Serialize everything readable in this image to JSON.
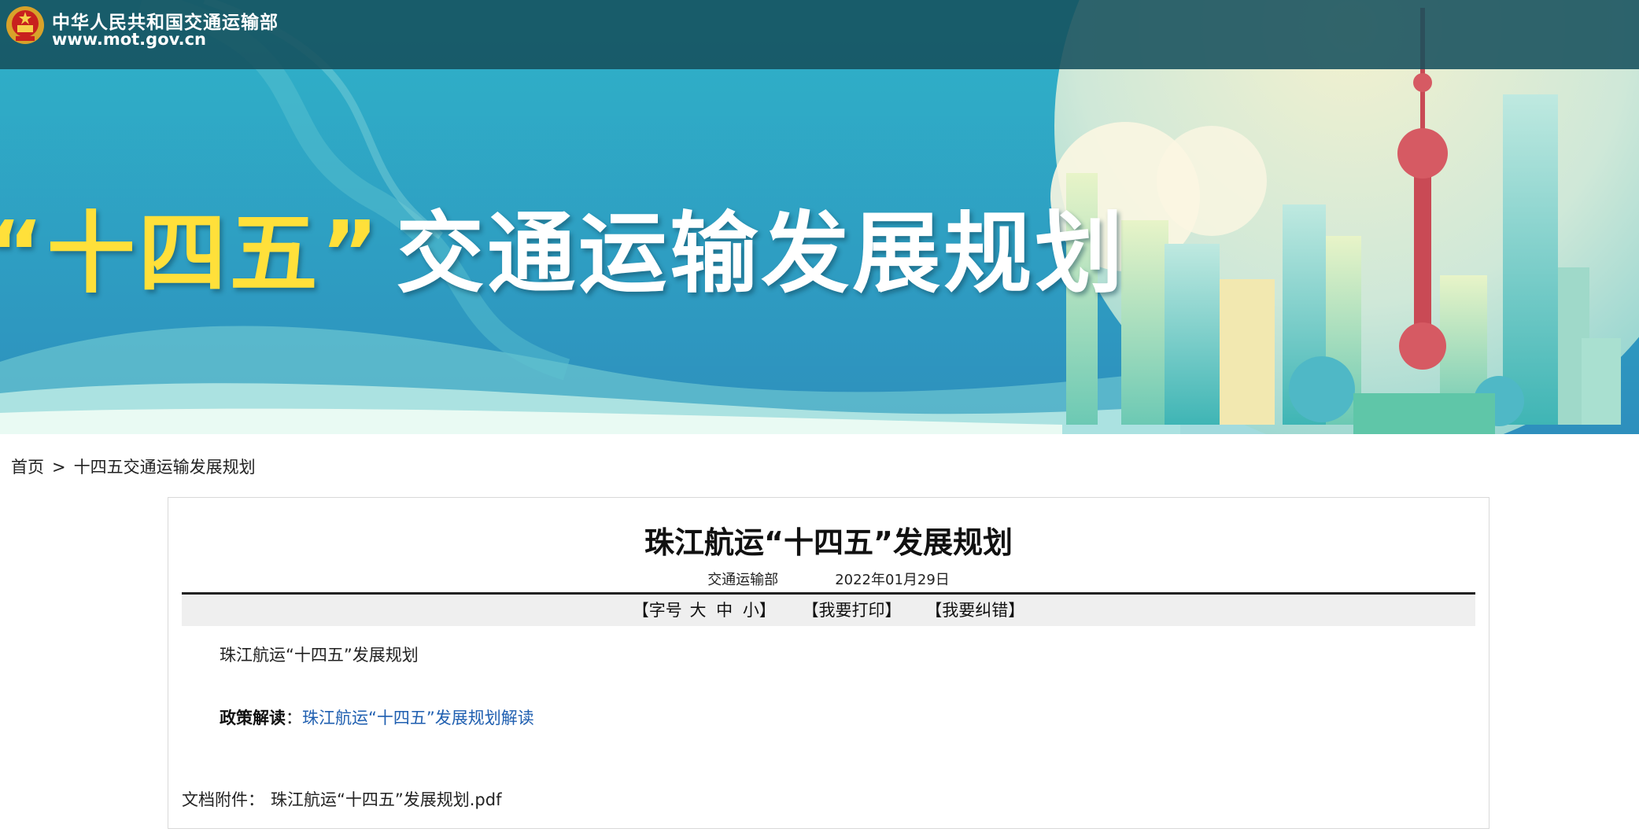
{
  "header": {
    "site_name": "中华人民共和国交通运输部",
    "site_url": "www.mot.gov.cn"
  },
  "banner": {
    "title_highlight": "“十四五”",
    "title_rest": "交通运输发展规划"
  },
  "breadcrumb": {
    "home": "首页",
    "separator": ">",
    "current": "十四五交通运输发展规划"
  },
  "article": {
    "title": "珠江航运“十四五”发展规划",
    "source": "交通运输部",
    "date": "2022年01月29日",
    "toolbar": {
      "font_open": "【字号",
      "font_large": "大",
      "font_medium": "中",
      "font_small": "小】",
      "print": "【我要打印】",
      "correct": "【我要纠错】"
    },
    "body": "珠江航运“十四五”发展规划",
    "policy_label": "政策解读",
    "policy_colon": "：",
    "policy_link": "珠江航运“十四五”发展规划解读",
    "attachment_label": "文档附件：",
    "attachment_file": "珠江航运“十四五”发展规划.pdf"
  },
  "colors": {
    "top_bar": "#16505c",
    "banner_sky": "#2b9ec0",
    "title_highlight": "#ffe03a",
    "link": "#1f5fb0"
  }
}
